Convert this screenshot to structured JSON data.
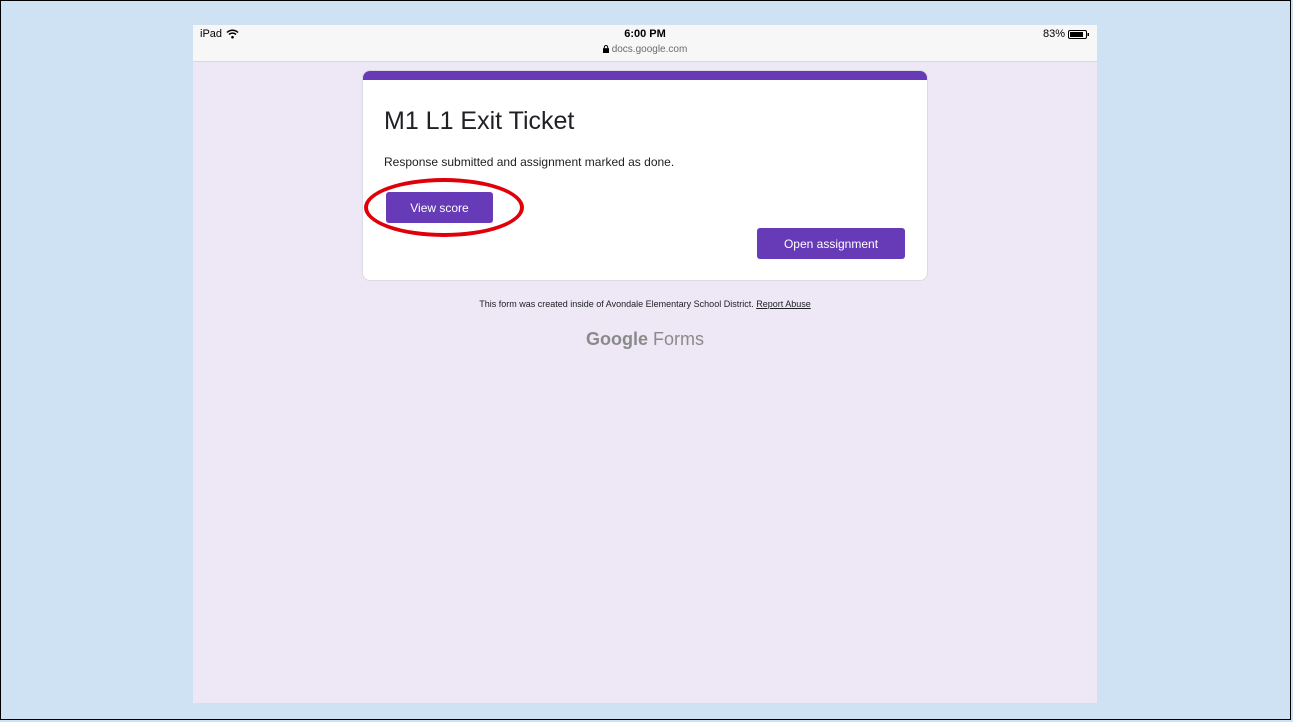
{
  "statusbar": {
    "device": "iPad",
    "time": "6:00 PM",
    "url": "docs.google.com",
    "battery": "83%"
  },
  "form": {
    "title": "M1 L1 Exit Ticket",
    "message": "Response submitted and assignment marked as done.",
    "view_score_label": "View score",
    "open_assignment_label": "Open assignment"
  },
  "footer": {
    "note": "This form was created inside of Avondale Elementary School District.",
    "report_link": "Report Abuse",
    "brand_google": "Google",
    "brand_forms": "Forms"
  },
  "colors": {
    "accent": "#673ab7",
    "page_bg": "#ede7f6",
    "slide_bg": "#cfe2f3",
    "annotation": "#e0000a"
  },
  "icons": [
    "wifi-icon",
    "lock-icon",
    "battery-icon"
  ]
}
